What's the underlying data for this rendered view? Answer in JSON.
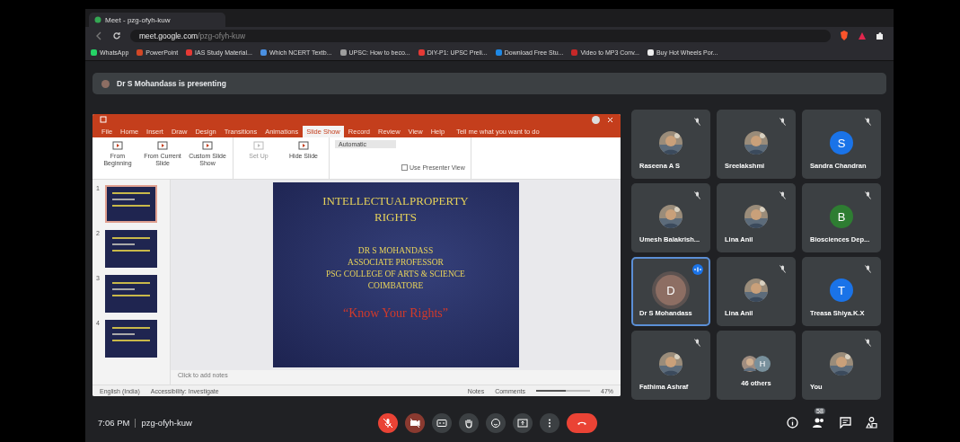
{
  "browser": {
    "tab_title": "Meet - pzg-ofyh-kuw",
    "url_host": "meet.google.com",
    "url_path": "/pzg-ofyh-kuw",
    "bookmarks": [
      {
        "label": "WhatsApp",
        "color": "#25d366"
      },
      {
        "label": "PowerPoint",
        "color": "#d24726"
      },
      {
        "label": "IAS Study Material...",
        "color": "#e53935"
      },
      {
        "label": "Which NCERT Textb...",
        "color": "#4a90e2"
      },
      {
        "label": "UPSC: How to beco...",
        "color": "#9e9e9e"
      },
      {
        "label": "DIY-P1: UPSC Preli...",
        "color": "#e53935"
      },
      {
        "label": "Download Free Stu...",
        "color": "#1e88e5"
      },
      {
        "label": "Video to MP3 Conv...",
        "color": "#c62828"
      },
      {
        "label": "Buy Hot Wheels Por...",
        "color": "#eeeeee"
      }
    ]
  },
  "presenting_banner": "Dr S Mohandass is presenting",
  "powerpoint": {
    "tabs": [
      {
        "label": "File",
        "selected": false
      },
      {
        "label": "Home",
        "selected": false
      },
      {
        "label": "Insert",
        "selected": false
      },
      {
        "label": "Draw",
        "selected": false
      },
      {
        "label": "Design",
        "selected": false
      },
      {
        "label": "Transitions",
        "selected": false
      },
      {
        "label": "Animations",
        "selected": false
      },
      {
        "label": "Slide Show",
        "selected": true
      },
      {
        "label": "Record",
        "selected": false
      },
      {
        "label": "Review",
        "selected": false
      },
      {
        "label": "View",
        "selected": false
      },
      {
        "label": "Help",
        "selected": false
      }
    ],
    "tell_me": "Tell me what you want to do",
    "ribbon_groups": [
      {
        "commands": [
          {
            "label": "From Beginning",
            "disabled": false
          },
          {
            "label": "From Current Slide",
            "disabled": false
          },
          {
            "label": "Custom Slide Show",
            "disabled": false
          }
        ]
      },
      {
        "commands": [
          {
            "label": "Set Up",
            "disabled": true
          },
          {
            "label": "Hide Slide",
            "disabled": false
          }
        ]
      },
      {
        "monitor_value": "Automatic",
        "checks": [
          {
            "label": "Use Presenter View",
            "checked": false
          }
        ]
      }
    ],
    "slides": [
      {
        "number": "1",
        "selected": true
      },
      {
        "number": "2",
        "selected": false
      },
      {
        "number": "3",
        "selected": false
      },
      {
        "number": "4",
        "selected": false
      }
    ],
    "slide": {
      "title_lines": [
        "INTELLECTUALPROPERTY",
        "RIGHTS"
      ],
      "author_lines": [
        "DR S MOHANDASS",
        "ASSOCIATE PROFESSOR",
        "PSG COLLEGE OF ARTS & SCIENCE",
        "COIMBATORE"
      ],
      "tagline": "“Know Your Rights”"
    },
    "notes_placeholder": "Click to add notes",
    "status": {
      "language": "English (India)",
      "accessibility": "Accessibility: Investigate",
      "notes": "Notes",
      "comments": "Comments",
      "zoom": "47%",
      "zoom_slider": {
        "level": 0.55
      }
    }
  },
  "participants": [
    {
      "name": "Raseena A S",
      "muted": true,
      "speaking": false
    },
    {
      "name": "Sreelakshmi",
      "muted": true,
      "speaking": false
    },
    {
      "name": "Sandra Chandran",
      "kind": "letter",
      "letter": "S",
      "color": "#1a73e8",
      "muted": true,
      "speaking": false
    },
    {
      "name": "Umesh Balakrish...",
      "muted": true,
      "speaking": false
    },
    {
      "name": "Lina Anil",
      "muted": true,
      "speaking": false
    },
    {
      "name": "Biosciences Dep...",
      "kind": "letter",
      "letter": "B",
      "color": "#2e7d32",
      "muted": true,
      "speaking": false
    },
    {
      "name": "Dr S Mohandass",
      "kind": "letter",
      "letter": "D",
      "color": "#8d6e63",
      "muted": false,
      "speaking": true
    },
    {
      "name": "Lina Anil",
      "muted": true,
      "speaking": false
    },
    {
      "name": "Treasa Shiya.K.X",
      "kind": "letter",
      "letter": "T",
      "color": "#1a73e8",
      "muted": true,
      "speaking": false
    },
    {
      "name": "Fathima Ashraf",
      "muted": true,
      "speaking": false
    },
    {
      "name": "46 others",
      "kind": "others",
      "letter": "H",
      "color": "#78909c",
      "muted": false,
      "speaking": false
    },
    {
      "name": "You",
      "muted": true,
      "speaking": false
    }
  ],
  "footer": {
    "time": "7:06 PM",
    "meeting_code": "pzg-ofyh-kuw",
    "people_count": "58",
    "controls": [
      {
        "kind": "mic",
        "off": true
      },
      {
        "kind": "camera",
        "off": true
      },
      {
        "kind": "captions",
        "off": false
      },
      {
        "kind": "hand",
        "off": false
      },
      {
        "kind": "emoji",
        "off": false
      },
      {
        "kind": "present",
        "off": false
      },
      {
        "kind": "more",
        "off": false
      },
      {
        "kind": "end-call",
        "off": true
      }
    ]
  }
}
